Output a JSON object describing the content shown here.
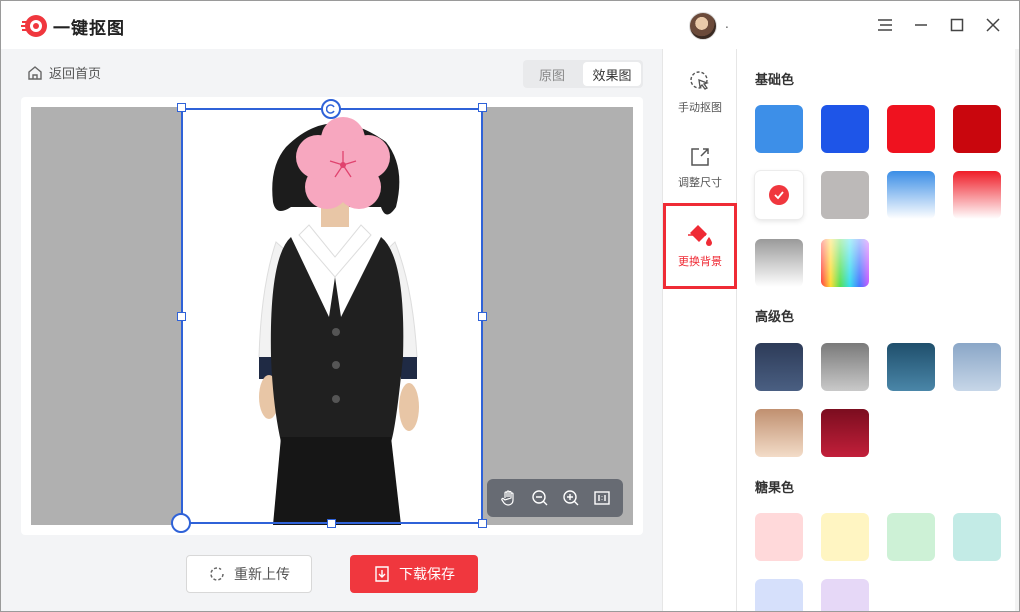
{
  "app": {
    "title": "一键抠图",
    "user_name": "."
  },
  "toolbar": {
    "back_label": "返回首页",
    "view_original": "原图",
    "view_result": "效果图"
  },
  "tools": [
    {
      "label": "手动抠图",
      "icon": "cursor-click-icon"
    },
    {
      "label": "调整尺寸",
      "icon": "resize-icon"
    },
    {
      "label": "更换背景",
      "icon": "paint-bucket-icon"
    }
  ],
  "actions": {
    "reupload_label": "重新上传",
    "save_label": "下载保存"
  },
  "panel": {
    "basic_title": "基础色",
    "advanced_title": "高级色",
    "candy_title": "糖果色"
  },
  "colors": {
    "accent": "#f0373e",
    "frame": "#2f62d8",
    "canvas_bg": "#b0b0b0"
  }
}
